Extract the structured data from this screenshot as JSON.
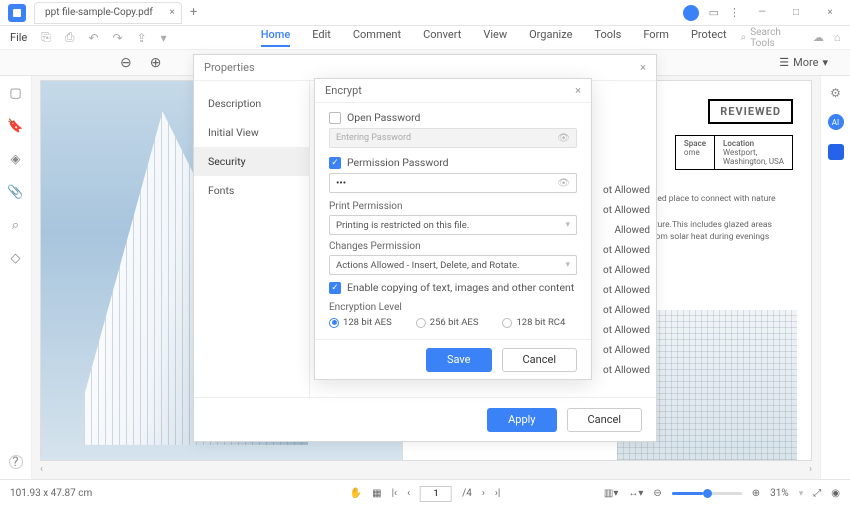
{
  "titlebar": {
    "tab_title": "ppt file-sample-Copy.pdf"
  },
  "menu": {
    "file": "File",
    "tabs": [
      "Home",
      "Edit",
      "Comment",
      "Convert",
      "View",
      "Organize",
      "Tools",
      "Form",
      "Protect"
    ],
    "active_tab_index": 0,
    "search_placeholder": "Search Tools"
  },
  "toolbar": {
    "more": "More"
  },
  "properties": {
    "title": "Properties",
    "items": [
      "Description",
      "Initial View",
      "Security",
      "Fonts"
    ],
    "active_index": 2,
    "allowed": [
      "ot Allowed",
      "ot Allowed",
      "Allowed",
      "ot Allowed",
      "ot Allowed",
      "ot Allowed",
      "ot Allowed",
      "ot Allowed",
      "ot Allowed",
      "ot Allowed"
    ],
    "apply": "Apply",
    "cancel": "Cancel"
  },
  "encrypt": {
    "title": "Encrypt",
    "open_password_label": "Open Password",
    "open_password_placeholder": "Entering Password",
    "permission_password_label": "Permission Password",
    "permission_password_value": "•••",
    "print_permission_label": "Print Permission",
    "print_permission_value": "Printing is restricted on this file.",
    "changes_permission_label": "Changes Permission",
    "changes_permission_value": "Actions Allowed - Insert, Delete, and Rotate.",
    "enable_copy_label": "Enable copying of text, images and other content",
    "encryption_level_label": "Encryption Level",
    "levels": [
      "128 bit AES",
      "256 bit AES",
      "128 bit RC4"
    ],
    "level_selected_index": 0,
    "save": "Save",
    "cancel": "Cancel"
  },
  "document": {
    "reviewed": "REVIEWED",
    "space_label": "Space",
    "space_value": "ome",
    "location_label": "Location",
    "location_value": "Westport,\nWashington, USA",
    "body1": "olated place to connect with nature",
    "body2": "erature.This includes glazed areas",
    "body3": "n from solar heat during evenings"
  },
  "statusbar": {
    "coords": "101.93 x 47.87 cm",
    "page_current": "1",
    "page_total": "/4",
    "zoom": "31%"
  }
}
